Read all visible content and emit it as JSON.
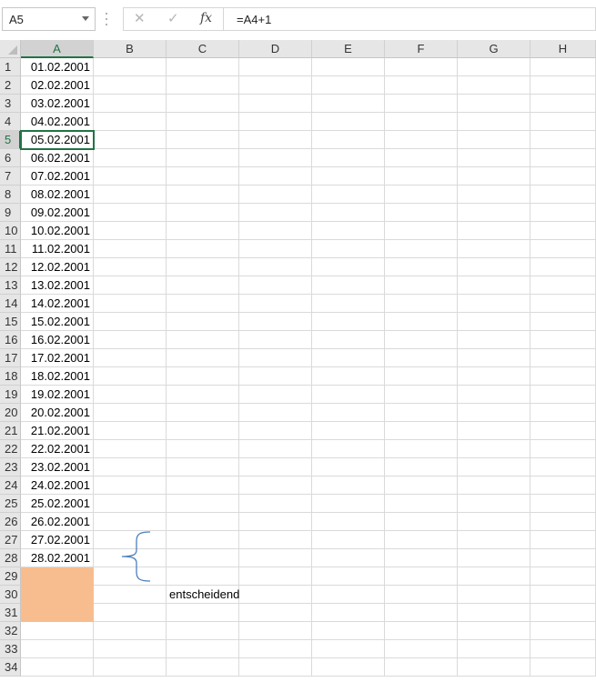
{
  "formula_bar": {
    "name_box": "A5",
    "cancel_icon": "cross-icon",
    "enter_icon": "check-icon",
    "fx_label": "fx",
    "formula": "=A4+1"
  },
  "columns": [
    "A",
    "B",
    "C",
    "D",
    "E",
    "F",
    "G",
    "H"
  ],
  "active_column": "A",
  "rows": [
    "1",
    "2",
    "3",
    "4",
    "5",
    "6",
    "7",
    "8",
    "9",
    "10",
    "11",
    "12",
    "13",
    "14",
    "15",
    "16",
    "17",
    "18",
    "19",
    "20",
    "21",
    "22",
    "23",
    "24",
    "25",
    "26",
    "27",
    "28",
    "29",
    "30",
    "31",
    "32",
    "33",
    "34"
  ],
  "column_a_values": [
    "01.02.2001",
    "02.02.2001",
    "03.02.2001",
    "04.02.2001",
    "05.02.2001",
    "06.02.2001",
    "07.02.2001",
    "08.02.2001",
    "09.02.2001",
    "10.02.2001",
    "11.02.2001",
    "12.02.2001",
    "13.02.2001",
    "14.02.2001",
    "15.02.2001",
    "16.02.2001",
    "17.02.2001",
    "18.02.2001",
    "19.02.2001",
    "20.02.2001",
    "21.02.2001",
    "22.02.2001",
    "23.02.2001",
    "24.02.2001",
    "25.02.2001",
    "26.02.2001",
    "27.02.2001",
    "28.02.2001",
    "",
    "",
    "",
    "",
    "",
    ""
  ],
  "highlight_rows": [
    29,
    30,
    31
  ],
  "highlight_color": "#f8bd8f",
  "annotation": {
    "text": "entscheidend",
    "brace_icon": "curly-brace-icon",
    "brace_color": "#4a7ebb"
  }
}
